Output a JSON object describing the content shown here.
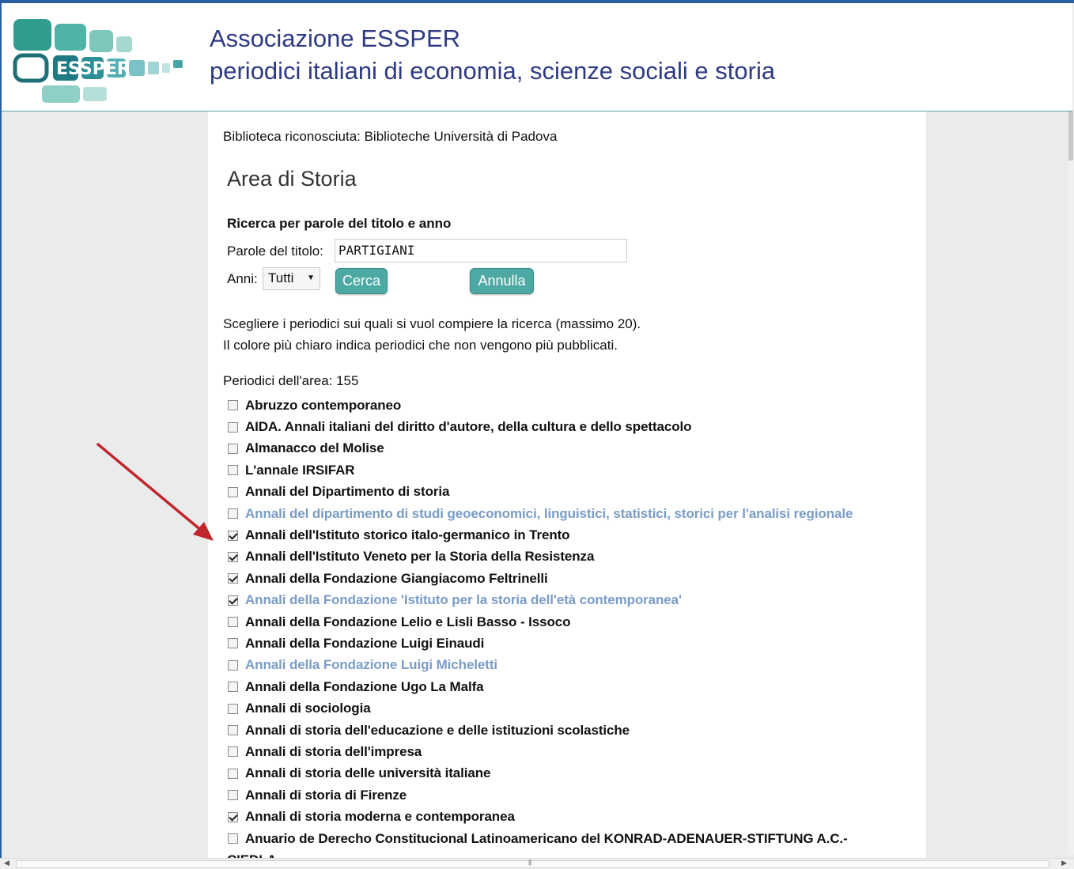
{
  "header": {
    "title_line1": "Associazione ESSPER",
    "title_line2": "periodici italiani di economia, scienze sociali e storia",
    "logo_text": "ESSPER"
  },
  "library_text": "Biblioteca riconosciuta: Biblioteche Università di Padova",
  "area_title": "Area di Storia",
  "search": {
    "heading": "Ricerca per parole del titolo e anno",
    "title_label": "Parole del titolo:",
    "title_value": "PARTIGIANI",
    "years_label": "Anni:",
    "years_selected": "Tutti",
    "search_button": "Cerca",
    "cancel_button": "Annulla"
  },
  "instructions": {
    "line1": "Scegliere i periodici sui quali si vuol compiere la ricerca (massimo 20).",
    "line2": "Il colore più chiaro indica periodici che non vengono più pubblicati."
  },
  "periodicals_count_label": "Periodici dell'area: 155",
  "periodicals": [
    {
      "label": "Abruzzo contemporaneo",
      "checked": false,
      "ceased": false
    },
    {
      "label": "AIDA. Annali italiani del diritto d'autore, della cultura e dello spettacolo",
      "checked": false,
      "ceased": false
    },
    {
      "label": "Almanacco del Molise",
      "checked": false,
      "ceased": false
    },
    {
      "label": "L'annale IRSIFAR",
      "checked": false,
      "ceased": false
    },
    {
      "label": "Annali del Dipartimento di storia",
      "checked": false,
      "ceased": false
    },
    {
      "label": "Annali del dipartimento di studi geoeconomici, linguistici, statistici, storici per l'analisi regionale",
      "checked": false,
      "ceased": true
    },
    {
      "label": "Annali dell'Istituto storico italo-germanico in Trento",
      "checked": true,
      "ceased": false
    },
    {
      "label": "Annali dell'Istituto Veneto per la Storia della Resistenza",
      "checked": true,
      "ceased": false
    },
    {
      "label": "Annali della Fondazione Giangiacomo Feltrinelli",
      "checked": true,
      "ceased": false
    },
    {
      "label": "Annali della Fondazione 'Istituto per la storia dell'età contemporanea'",
      "checked": true,
      "ceased": true
    },
    {
      "label": "Annali della Fondazione Lelio e Lisli Basso - Issoco",
      "checked": false,
      "ceased": false
    },
    {
      "label": "Annali della Fondazione Luigi Einaudi",
      "checked": false,
      "ceased": false
    },
    {
      "label": "Annali della Fondazione Luigi Micheletti",
      "checked": false,
      "ceased": true
    },
    {
      "label": "Annali della Fondazione Ugo La Malfa",
      "checked": false,
      "ceased": false
    },
    {
      "label": "Annali di sociologia",
      "checked": false,
      "ceased": false
    },
    {
      "label": "Annali di storia dell'educazione e delle istituzioni scolastiche",
      "checked": false,
      "ceased": false
    },
    {
      "label": "Annali di storia dell'impresa",
      "checked": false,
      "ceased": false
    },
    {
      "label": "Annali di storia delle università italiane",
      "checked": false,
      "ceased": false
    },
    {
      "label": "Annali di storia di Firenze",
      "checked": false,
      "ceased": false
    },
    {
      "label": "Annali di storia moderna e contemporanea",
      "checked": true,
      "ceased": false
    },
    {
      "label": "Anuario de Derecho Constitucional Latinoamericano del KONRAD-ADENAUER-STIFTUNG A.C.-",
      "checked": false,
      "ceased": false
    },
    {
      "label": "CIEDLA",
      "checked": false,
      "ceased": false
    }
  ],
  "colors": {
    "title": "#2e3a83",
    "button": "#4da9a3",
    "ceased_text": "#7a9cc6",
    "arrow": "#c0272d"
  }
}
